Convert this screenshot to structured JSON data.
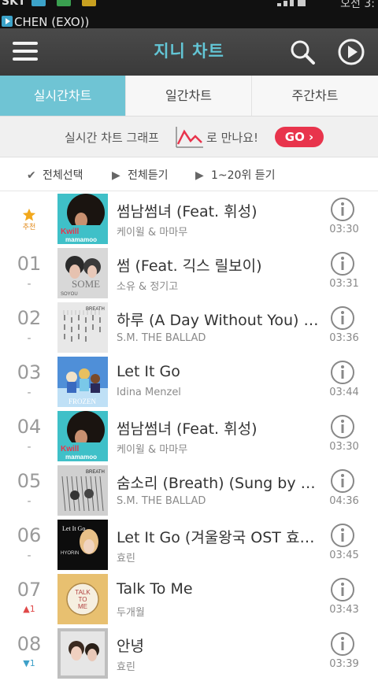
{
  "status_bar": {
    "carrier": "SKT",
    "now_playing": "CHEN (EXO))",
    "time": "오전 3:"
  },
  "app_bar": {
    "title": "지니 차트",
    "menu_icon": "hamburger-icon",
    "search_icon": "search-icon",
    "play_icon": "play-circle-icon",
    "accent_color": "#63c6d6"
  },
  "tabs": [
    {
      "label": "실시간차트",
      "active": true
    },
    {
      "label": "일간차트",
      "active": false
    },
    {
      "label": "주간차트",
      "active": false
    }
  ],
  "banner": {
    "text_before": "실시간 차트 그래프",
    "text_after": "로 만나요!",
    "button_label": "GO ›",
    "button_color": "#e8344c"
  },
  "toolbar": {
    "select_all": "전체선택",
    "play_all": "전체듣기",
    "play_top": "1~20위 듣기"
  },
  "songs": [
    {
      "rank": "",
      "badge": "추천",
      "change": "",
      "change_dir": "none",
      "title": "썸남썸녀 (Feat. 휘성)",
      "artist": "케이윌 & 마마무",
      "duration": "03:30",
      "art": "afro"
    },
    {
      "rank": "01",
      "badge": "",
      "change": "-",
      "change_dir": "none",
      "title": "썸 (Feat. 긱스 릴보이)",
      "artist": "소유 & 정기고",
      "duration": "03:31",
      "art": "some"
    },
    {
      "rank": "02",
      "badge": "",
      "change": "-",
      "change_dir": "none",
      "title": "하루 (A Day Without You) (Sung by ...",
      "artist": "S.M. THE BALLAD",
      "duration": "03:36",
      "art": "breath"
    },
    {
      "rank": "03",
      "badge": "",
      "change": "-",
      "change_dir": "none",
      "title": "Let It Go",
      "artist": "Idina Menzel",
      "duration": "03:44",
      "art": "frozen"
    },
    {
      "rank": "04",
      "badge": "",
      "change": "-",
      "change_dir": "none",
      "title": "썸남썸녀 (Feat. 휘성)",
      "artist": "케이윌 & 마마무",
      "duration": "03:30",
      "art": "afro"
    },
    {
      "rank": "05",
      "badge": "",
      "change": "-",
      "change_dir": "none",
      "title": "숨소리 (Breath) (Sung by 종현 & 태연...",
      "artist": "S.M. THE BALLAD",
      "duration": "04:36",
      "art": "breath2"
    },
    {
      "rank": "06",
      "badge": "",
      "change": "-",
      "change_dir": "none",
      "title": "Let It Go (겨울왕국 OST 효린 버전...",
      "artist": "효린",
      "duration": "03:45",
      "art": "hyorin"
    },
    {
      "rank": "07",
      "badge": "",
      "change": "1",
      "change_dir": "up",
      "title": "Talk To Me",
      "artist": "두개월",
      "duration": "03:43",
      "art": "talk"
    },
    {
      "rank": "08",
      "badge": "",
      "change": "1",
      "change_dir": "down",
      "title": "안녕",
      "artist": "효린",
      "duration": "03:39",
      "art": "annyeong"
    }
  ],
  "art_text": {
    "afro_logo": "Kwill",
    "afro_sub": "mamamoo",
    "some_title": "SOME",
    "some_sub": "SOYOU",
    "breath_label": "BREATH",
    "frozen_label": "FROZEN",
    "hyorin_title": "Let It Go",
    "hyorin_name": "HYORIN",
    "talk_line1": "TALK",
    "talk_line2": "TO",
    "talk_line3": "ME"
  }
}
